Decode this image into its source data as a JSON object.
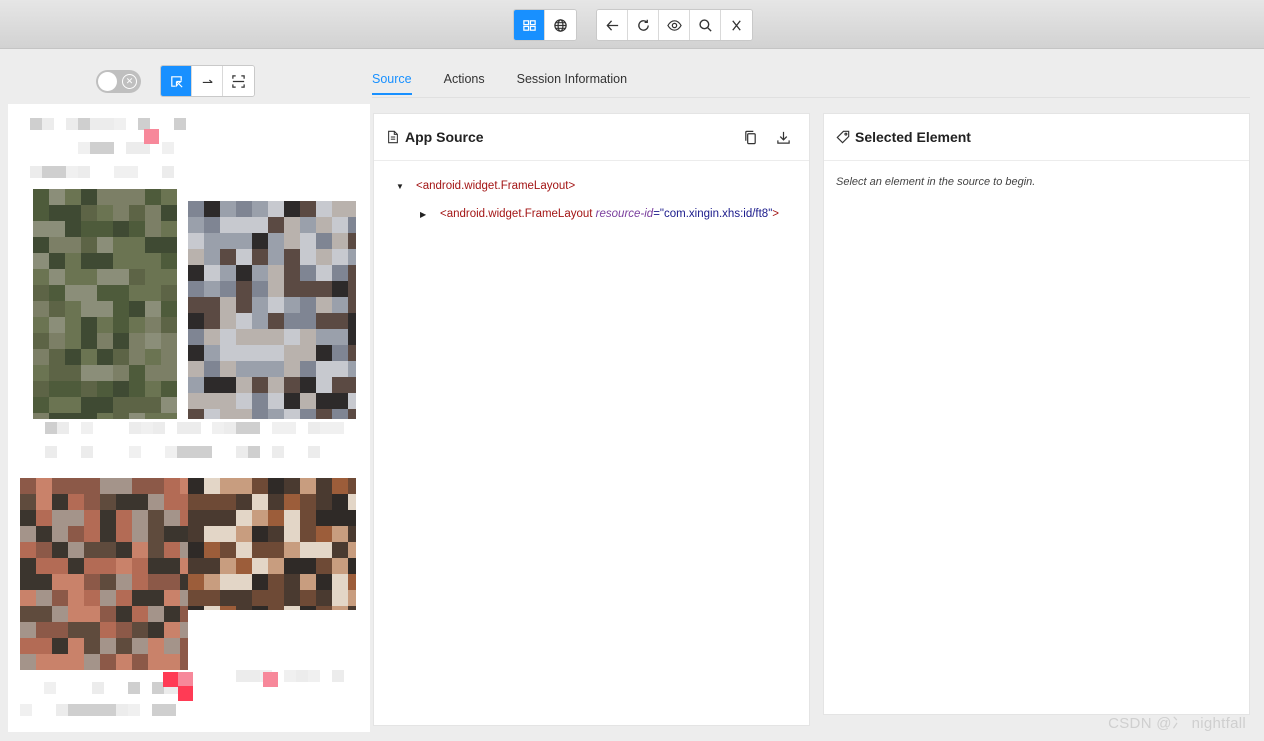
{
  "toolbar": {
    "view_group": [
      {
        "name": "native-app-mode-button",
        "icon": "grid-icon",
        "active": true
      },
      {
        "name": "web-mode-button",
        "icon": "globe-icon",
        "active": false
      }
    ],
    "nav_group": [
      {
        "name": "back-button",
        "icon": "arrow-left-icon"
      },
      {
        "name": "refresh-button",
        "icon": "refresh-icon"
      },
      {
        "name": "inspect-button",
        "icon": "eye-icon"
      },
      {
        "name": "search-button",
        "icon": "search-icon"
      },
      {
        "name": "quit-session-button",
        "icon": "close-icon"
      }
    ]
  },
  "device_controls": {
    "toggle_on": false,
    "modes": [
      {
        "name": "select-element-mode",
        "icon": "select-cursor-icon",
        "active": true
      },
      {
        "name": "swipe-mode",
        "icon": "arrow-right-icon",
        "active": false
      },
      {
        "name": "tap-coordinates-mode",
        "icon": "scan-icon",
        "active": false
      }
    ]
  },
  "tabs": [
    {
      "label": "Source",
      "active": true
    },
    {
      "label": "Actions",
      "active": false
    },
    {
      "label": "Session Information",
      "active": false
    }
  ],
  "app_source": {
    "title": "App Source",
    "actions": [
      {
        "icon": "copy-icon"
      },
      {
        "icon": "download-icon"
      }
    ],
    "tree": [
      {
        "tag": "<android.widget.FrameLayout>",
        "expanded": true
      },
      {
        "tag": "<android.widget.FrameLayout",
        "attr_name": "resource-id",
        "attr_value": "\"com.xingin.xhs:id/ft8\"",
        "close": ">",
        "expanded": false
      }
    ]
  },
  "selected_element": {
    "title": "Selected Element",
    "hint": "Select an element in the source to begin."
  },
  "watermark": "CSDN @冫 nightfall",
  "colors": {
    "accent": "#1890ff"
  }
}
